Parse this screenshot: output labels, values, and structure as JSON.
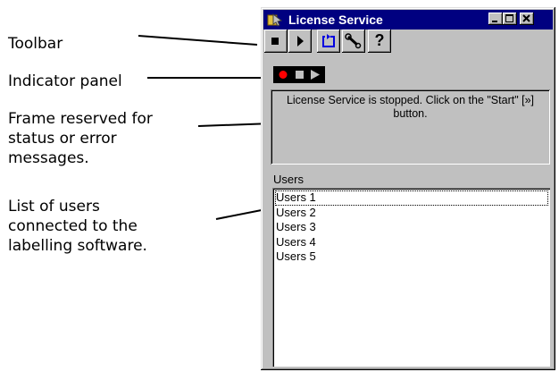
{
  "callouts": {
    "toolbar": "Toolbar",
    "indicator_panel": "Indicator panel",
    "status_frame": [
      "Frame reserved for",
      "status or error",
      "messages."
    ],
    "users_list": [
      "List of users",
      "connected to the",
      "labelling software."
    ]
  },
  "window": {
    "title": "License Service",
    "title_bar_color": "#000080",
    "window_buttons": [
      "minimize-icon",
      "maximize-icon",
      "close-icon"
    ]
  },
  "toolbar": {
    "buttons": [
      {
        "name": "stop",
        "icon": "stop-icon"
      },
      {
        "name": "start",
        "icon": "play-icon"
      },
      {
        "name": "refresh",
        "icon": "refresh-icon"
      },
      {
        "name": "settings",
        "icon": "wrench-icon"
      },
      {
        "name": "help",
        "icon": "help-icon",
        "label": "?"
      }
    ]
  },
  "indicator": {
    "icons": [
      "red-dot-icon",
      "stop-square-icon",
      "play-triangle-icon"
    ],
    "active_color": "#ff0000"
  },
  "status": {
    "message": "License Service is stopped. Click on the \"Start\" [»] button."
  },
  "users": {
    "label": "Users",
    "items": [
      "Users 1",
      "Users 2",
      "Users 3",
      "Users 4",
      "Users 5"
    ]
  }
}
